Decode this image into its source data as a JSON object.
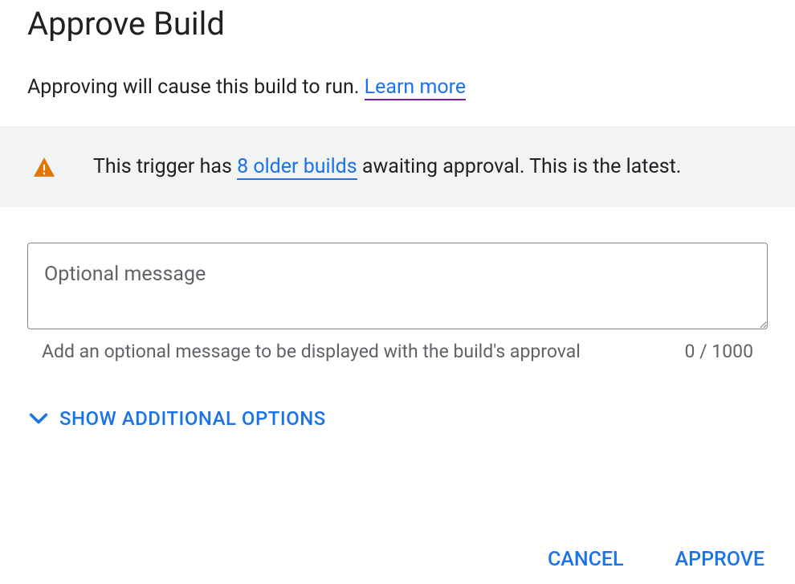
{
  "dialog": {
    "title": "Approve Build",
    "subtitle_pre": "Approving will cause this build to run. ",
    "learn_more": "Learn more"
  },
  "banner": {
    "pre": "This trigger has ",
    "link": "8 older builds",
    "post": " awaiting approval. This is the latest."
  },
  "message_field": {
    "placeholder": "Optional message",
    "helper": "Add an optional message to be displayed with the build's approval",
    "counter": "0 / 1000"
  },
  "expander": {
    "label": "SHOW ADDITIONAL OPTIONS"
  },
  "actions": {
    "cancel": "CANCEL",
    "approve": "APPROVE"
  }
}
